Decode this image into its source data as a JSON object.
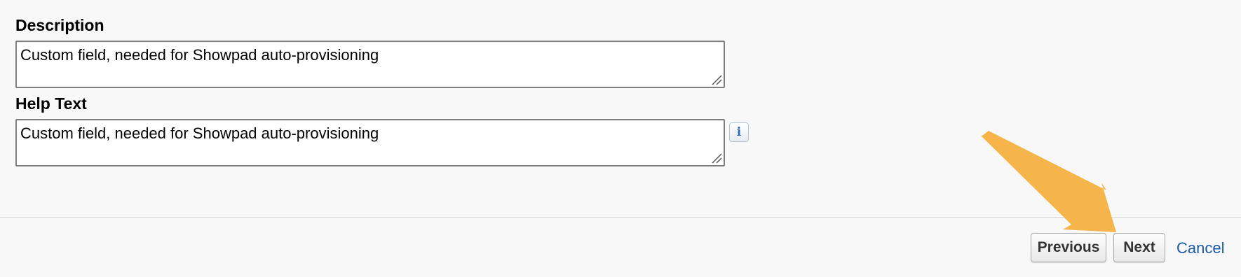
{
  "description": {
    "label": "Description",
    "value": "Custom field, needed for Showpad auto-provisioning"
  },
  "help_text": {
    "label": "Help Text",
    "value": "Custom field, needed for Showpad auto-provisioning",
    "info_icon_glyph": "i"
  },
  "footer": {
    "previous_label": "Previous",
    "next_label": "Next",
    "cancel_label": "Cancel"
  },
  "colors": {
    "arrow": "#f5b54a",
    "link": "#1a5aa6",
    "info_icon": "#2c6bb8"
  }
}
